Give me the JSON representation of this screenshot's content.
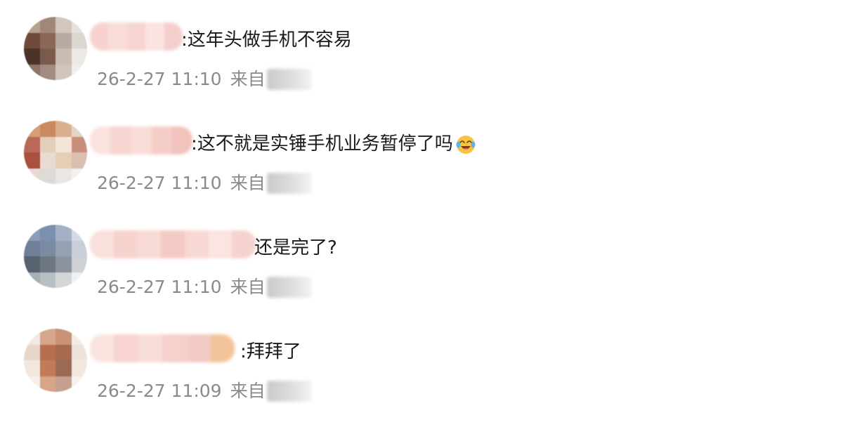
{
  "comments": [
    {
      "text": ":这年头做手机不容易",
      "time": "26-2-27 11:10",
      "from_label": "来自",
      "emoji": null
    },
    {
      "text": ":这不就是实锤手机业务暂停了吗",
      "time": "26-2-27 11:10",
      "from_label": "来自",
      "emoji": "laughing-with-tears-emoji"
    },
    {
      "text": "还是完了?",
      "time": "26-2-27 11:10",
      "from_label": "来自",
      "emoji": null
    },
    {
      "text": ":拜拜了",
      "time": "26-2-27 11:09",
      "from_label": "来自",
      "emoji": null
    }
  ],
  "colors": {
    "text": "#1a1a1a",
    "meta": "#8a8a8a",
    "background": "#ffffff"
  }
}
